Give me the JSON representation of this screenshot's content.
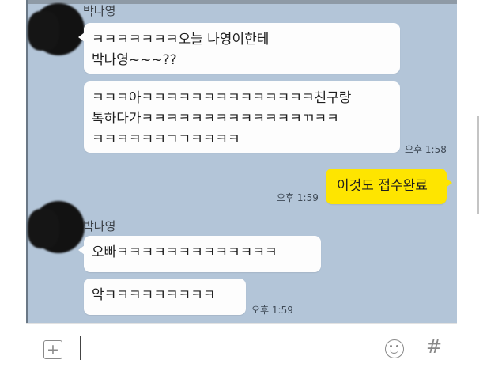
{
  "chat": {
    "sender_name_1": "박나영",
    "sender_name_2": "박나영",
    "messages": [
      "ㅋㅋㅋㅋㅋㅋㅋ오늘 나영이한테\n박나영~~~??",
      "ㅋㅋㅋ아ㅋㅋㅋㅋㅋㅋㅋㅋㅋㅋㅋㅋㅋㅋ친구랑\n톡하다가ㅋㅋㅋㅋㅋㅋㅋㅋㅋㅋㅋㅋㅋㄲㅋㅋ\nㅋㅋㅋㅋㅋㅋㄱㄱㅋㅋㅋㅋ",
      "이것도 접수완료",
      "오빠ㅋㅋㅋㅋㅋㅋㅋㅋㅋㅋㅋㅋㅋ",
      "악ㅋㅋㅋㅋㅋㅋㅋㅋㅋ"
    ],
    "times": [
      "오후 1:58",
      "오후 1:59",
      "오후 1:59"
    ]
  },
  "input_bar": {
    "icons": [
      "plus-icon",
      "emoji-icon",
      "hash-icon"
    ],
    "hash_glyph": "#"
  },
  "colors": {
    "chat_background": "#b3c5d8",
    "my_bubble": "#fee500",
    "other_bubble": "#fdfdfd"
  }
}
